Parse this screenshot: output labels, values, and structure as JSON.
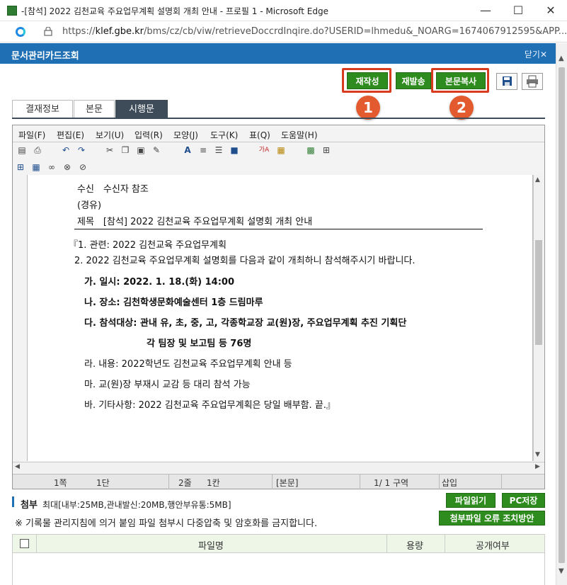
{
  "window": {
    "title": "-[참석] 2022 김천교육 주요업무계획 설명회 개최 안내 - 프로필 1 - Microsoft Edge",
    "minimize": "—",
    "maximize": "☐",
    "close": "✕"
  },
  "address": {
    "url_prefix": "https://",
    "url_host": "klef.gbe.kr",
    "url_rest": "/bms/cz/cb/viw/retrieveDoccrdInqire.do?USERID=lhmedu&_NOARG=1674067912595&APP..."
  },
  "header": {
    "title": "문서관리카드조회",
    "close_label": "닫기✕"
  },
  "actions": {
    "rewrite": "재작성",
    "resend": "재발송",
    "copy_body": "본문복사",
    "badge1": "1",
    "badge2": "2"
  },
  "tabs": {
    "approval_info": "결재정보",
    "body": "본문",
    "enforcement": "시행문"
  },
  "editor": {
    "menu": [
      "파일(F)",
      "편집(E)",
      "보기(U)",
      "입력(R)",
      "모양(J)",
      "도구(K)",
      "표(Q)",
      "도움말(H)"
    ],
    "doc": {
      "recipient": "수신　수신자 참조",
      "via": "(경유)",
      "subject": "제목　[참석] 2022 김천교육 주요업무계획 설명회 개최 안내",
      "item1": "『1. 관련: 2022 김천교육 주요업무계획",
      "item2": "2. 2022 김천교육 주요업무계획 설명회를 다음과 같이 개최하니 참석해주시기 바랍니다.",
      "ga": "가. 일시: 2022. 1. 18.(화) 14:00",
      "na": "나. 장소: 김천학생문화예술센터 1층 드림마루",
      "da": "다. 참석대상: 관내 유, 초, 중, 고, 각종학교장 교(원)장, 주요업무계획 추진 기획단",
      "da2": "각 팀장 및 보고팀 등 76명",
      "ra": "라. 내용: 2022학년도 김천교육 주요업무계획 안내 등",
      "ma": "마. 교(원)장 부재시 교감 등 대리 참석 가능",
      "ba": "바. 기타사항: 2022 김천교육 주요업무계획은 당일 배부함.  끝.』"
    },
    "status": {
      "page": "1쪽",
      "section": "1단",
      "line": "2줄",
      "col": "1칸",
      "mode": "[본문]",
      "area": "1/  1 구역",
      "insert": "삽입"
    }
  },
  "attachments": {
    "label": "첨부",
    "limits": "최대[내부:25MB,관내발신:20MB,행안부유통:5MB]",
    "notice": "※ 기록물 관리지침에 의거 붙임 파일 첨부시 다중압축 및 암호화를 금지합니다.",
    "read_button": "파일읽기",
    "save_button": "PC저장",
    "error_button": "첨부파일 오류 조치방안",
    "columns": [
      "파일명",
      "용량",
      "공개여부"
    ]
  },
  "colors": {
    "header_blue": "#1f6fb5",
    "button_green": "#2e8b1e",
    "highlight_red": "#d83c1f",
    "badge_orange": "#e25a2e",
    "tab_dark": "#3e4c5a"
  }
}
